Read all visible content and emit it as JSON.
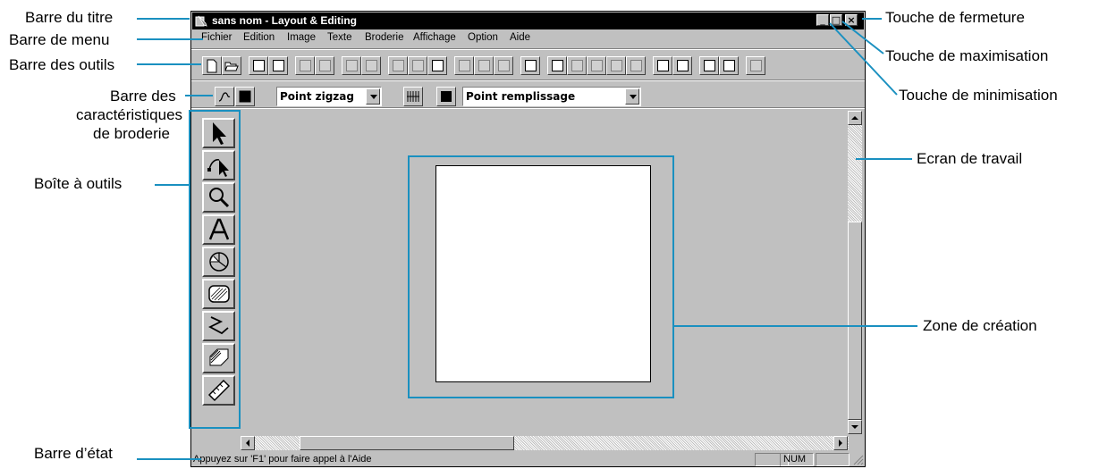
{
  "window": {
    "title": "sans nom - Layout & Editing",
    "buttons": {
      "minimize": "_",
      "maximize": "□",
      "close": "×"
    }
  },
  "menu": [
    "Fichier",
    "Edition",
    "Image",
    "Texte",
    "Broderie",
    "Affichage",
    "Option",
    "Aide"
  ],
  "props": {
    "line_stitch": "Point zigzag",
    "fill_stitch": "Point remplissage"
  },
  "status": {
    "message": "Appuyez sur 'F1' pour faire appel à l'Aide",
    "num": "NUM"
  },
  "tools": [
    "select-arrow-icon",
    "point-edit-icon",
    "zoom-icon",
    "text-icon",
    "circle-arc-icon",
    "rectangle-icon",
    "outline-icon",
    "stamp-icon",
    "measure-icon"
  ],
  "annotations": {
    "title_bar": "Barre du titre",
    "menu_bar": "Barre de menu",
    "tool_bar": "Barre des outils",
    "props_bar_line1": "Barre des",
    "props_bar_line2": "caractéristiques",
    "props_bar_line3": "de broderie",
    "tool_box": "Boîte à outils",
    "status_bar": "Barre d’état",
    "close_button": "Touche de fermeture",
    "maximize_button": "Touche de maximisation",
    "minimize_button": "Touche de minimisation",
    "work_screen": "Ecran de travail",
    "design_area": "Zone de création"
  },
  "colors": {
    "annotation_line": "#1a90c0",
    "titlebar": "#000000",
    "chrome": "#c0c0c0"
  }
}
